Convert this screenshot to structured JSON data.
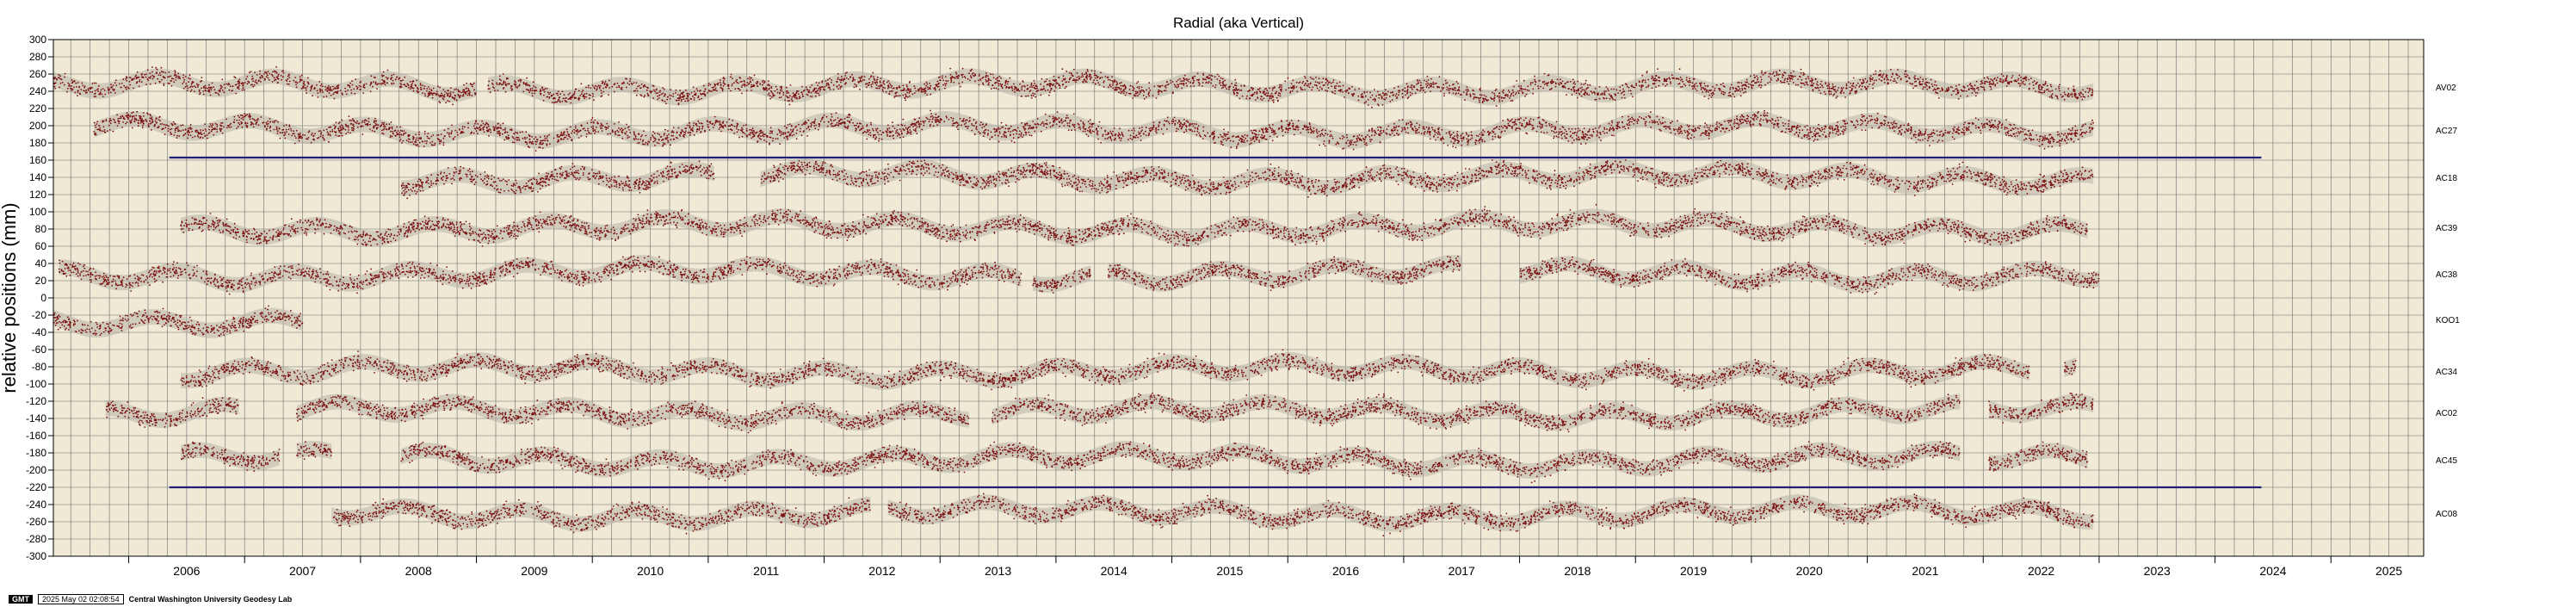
{
  "chart_data": {
    "type": "scatter",
    "title": "Radial (aka Vertical)",
    "ylabel": "relative positions (mm)",
    "xlabel": "",
    "xlim": [
      2005.35,
      2025.8
    ],
    "ylim": [
      -300,
      300
    ],
    "y_ticks": [
      300,
      280,
      260,
      240,
      220,
      200,
      180,
      160,
      140,
      120,
      100,
      80,
      60,
      40,
      20,
      0,
      -20,
      -40,
      -60,
      -80,
      -100,
      -120,
      -140,
      -160,
      -180,
      -200,
      -220,
      -240,
      -260,
      -280,
      -300
    ],
    "x_tick_years": [
      "2006",
      "2007",
      "2008",
      "2009",
      "2010",
      "2011",
      "2012",
      "2013",
      "2014",
      "2015",
      "2016",
      "2017",
      "2018",
      "2019",
      "2020",
      "2021",
      "2022",
      "2023",
      "2024",
      "2025"
    ],
    "grid": true,
    "point_color": "#7a0f0f",
    "band_color": "#b8b2a8",
    "background_color": "#efe9d6",
    "series": [
      {
        "name": "AV02",
        "offset": 245,
        "segments": [
          [
            2005.35,
            2009.0
          ],
          [
            2009.1,
            2022.95
          ]
        ]
      },
      {
        "name": "AC27",
        "offset": 195,
        "segments": [
          [
            2005.7,
            2022.95
          ]
        ]
      },
      {
        "name": "AC18",
        "offset": 140,
        "segments": [
          [
            2008.35,
            2011.05
          ],
          [
            2011.45,
            2022.95
          ]
        ]
      },
      {
        "name": "AC39",
        "offset": 82,
        "segments": [
          [
            2006.45,
            2022.9
          ]
        ]
      },
      {
        "name": "AC38",
        "offset": 28,
        "segments": [
          [
            2005.4,
            2012.05
          ],
          [
            2012.05,
            2013.7
          ],
          [
            2013.8,
            2014.3
          ],
          [
            2014.45,
            2017.5
          ],
          [
            2018.0,
            2023.0
          ]
        ]
      },
      {
        "name": "KOO1",
        "offset": -25,
        "segments": [
          [
            2005.35,
            2007.5
          ]
        ]
      },
      {
        "name": "AC34",
        "offset": -85,
        "segments": [
          [
            2006.45,
            2022.4
          ],
          [
            2022.7,
            2022.8
          ]
        ]
      },
      {
        "name": "AC02",
        "offset": -133,
        "segments": [
          [
            2005.8,
            2006.95
          ],
          [
            2007.45,
            2013.25
          ],
          [
            2013.45,
            2021.8
          ],
          [
            2022.05,
            2022.95
          ]
        ]
      },
      {
        "name": "AC45",
        "offset": -188,
        "segments": [
          [
            2006.45,
            2007.3
          ],
          [
            2007.45,
            2007.75
          ],
          [
            2008.35,
            2012.25
          ],
          [
            2012.25,
            2021.8
          ],
          [
            2022.05,
            2022.9
          ]
        ]
      },
      {
        "name": "AC08",
        "offset": -250,
        "segments": [
          [
            2007.75,
            2012.4
          ],
          [
            2012.55,
            2022.95
          ]
        ]
      }
    ],
    "reference_lines": [
      {
        "y": 163,
        "x_start": 2006.35,
        "x_end": 2024.4,
        "color": "#1f1f7a"
      },
      {
        "y": -220,
        "x_start": 2006.35,
        "x_end": 2024.4,
        "color": "#1f1f7a"
      }
    ]
  },
  "footer": {
    "gmt": "GMT",
    "timestamp": "2025 May 02 02:08:54",
    "credit": "Central Washington University Geodesy Lab"
  }
}
